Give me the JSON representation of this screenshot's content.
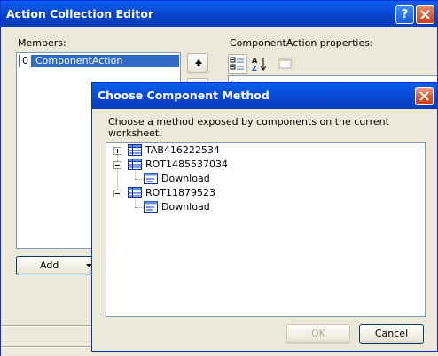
{
  "outer_window": {
    "title": "Action Collection Editor",
    "help_label": "?",
    "members_label": "Members:",
    "members": [
      {
        "index": "0",
        "name": "ComponentAction"
      }
    ],
    "add_label": "Add",
    "properties_label": "ComponentAction properties:"
  },
  "dialog": {
    "title": "Choose Component Method",
    "description": "Choose a method exposed by components on the current worksheet.",
    "tree": {
      "nodes": [
        {
          "name": "TAB416222534"
        },
        {
          "name": "ROT1485537034",
          "children": [
            {
              "name": "Download"
            }
          ]
        },
        {
          "name": "ROT11879523",
          "children": [
            {
              "name": "Download"
            }
          ]
        }
      ]
    },
    "ok_label": "OK",
    "cancel_label": "Cancel"
  },
  "colors": {
    "titlebar": "#0a5ff1",
    "selection": "#316ac5",
    "dialog_face": "#ece9d8"
  }
}
